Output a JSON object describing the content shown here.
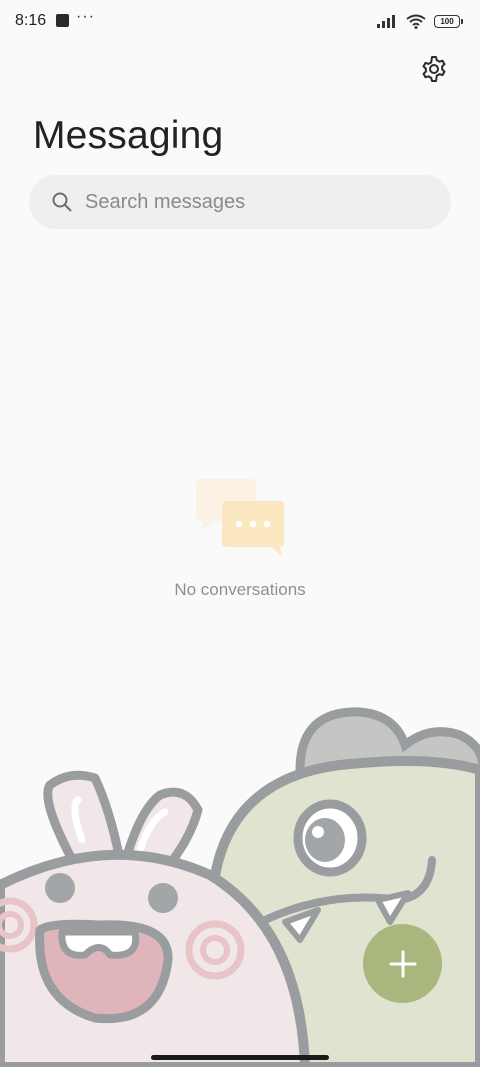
{
  "status_bar": {
    "time": "8:16",
    "overflow": "···",
    "battery": "100",
    "icons": [
      "app-notification-icon",
      "signal-icon",
      "wifi-icon",
      "battery-icon"
    ]
  },
  "header": {
    "title": "Messaging",
    "settings_icon": "gear-icon"
  },
  "search": {
    "placeholder": "Search messages",
    "value": ""
  },
  "empty_state": {
    "icon": "chat-bubbles-icon",
    "text": "No conversations"
  },
  "fab": {
    "icon": "plus-icon",
    "color": "#a9b77e"
  },
  "colors": {
    "background": "#fafafa",
    "accent": "#a9b77e",
    "search_bg": "#efefef"
  }
}
